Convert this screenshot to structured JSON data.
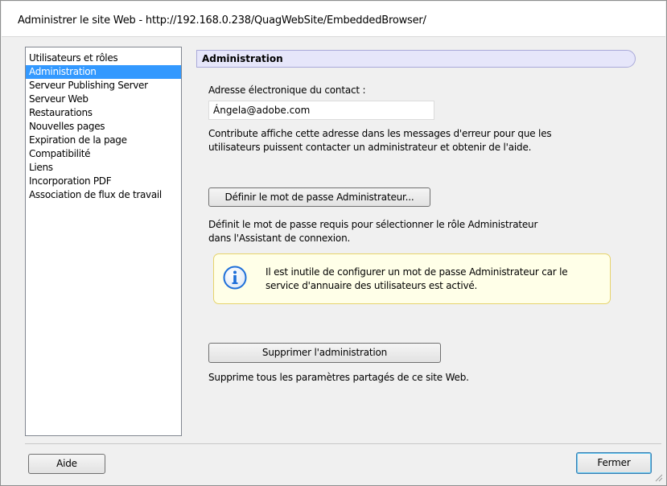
{
  "window": {
    "title": "Administrer le site Web - http://192.168.0.238/QuagWebSite/EmbeddedBrowser/"
  },
  "sidebar": {
    "items": [
      {
        "label": "Utilisateurs et rôles",
        "selected": false
      },
      {
        "label": "Administration",
        "selected": true
      },
      {
        "label": "Serveur Publishing Server",
        "selected": false
      },
      {
        "label": "Serveur Web",
        "selected": false
      },
      {
        "label": "Restaurations",
        "selected": false
      },
      {
        "label": "Nouvelles pages",
        "selected": false
      },
      {
        "label": "Expiration de la page",
        "selected": false
      },
      {
        "label": "Compatibilité",
        "selected": false
      },
      {
        "label": "Liens",
        "selected": false
      },
      {
        "label": "Incorporation PDF",
        "selected": false
      },
      {
        "label": "Association de flux de travail",
        "selected": false
      }
    ]
  },
  "main": {
    "section_title": "Administration",
    "contact_label": "Adresse électronique du contact :",
    "contact_value": "Ángela@adobe.com",
    "contact_desc_line1": "Contribute affiche cette adresse dans les messages d'erreur pour que les",
    "contact_desc_line2": "utilisateurs puissent contacter un administrateur et obtenir de l'aide.",
    "set_password_button": "Définir le mot de passe Administrateur...",
    "password_desc_line1": "Définit le mot de passe requis pour sélectionner le rôle Administrateur",
    "password_desc_line2": "dans l'Assistant de connexion.",
    "info_line1": "Il est inutile de configurer un mot de passe Administrateur car le",
    "info_line2": "service d'annuaire des utilisateurs est activé.",
    "remove_button": "Supprimer l'administration",
    "remove_desc": "Supprime tous les paramètres partagés de ce site Web."
  },
  "footer": {
    "help_button": "Aide",
    "close_button": "Fermer"
  },
  "colors": {
    "selection": "#3399ff",
    "section_header_bg": "#e6e6fa",
    "info_bg": "#ffffe8",
    "info_border": "#e6d36b",
    "info_icon": "#1e6fd9"
  },
  "icons": {
    "info": "info-icon",
    "grip": "resize-grip-icon"
  }
}
